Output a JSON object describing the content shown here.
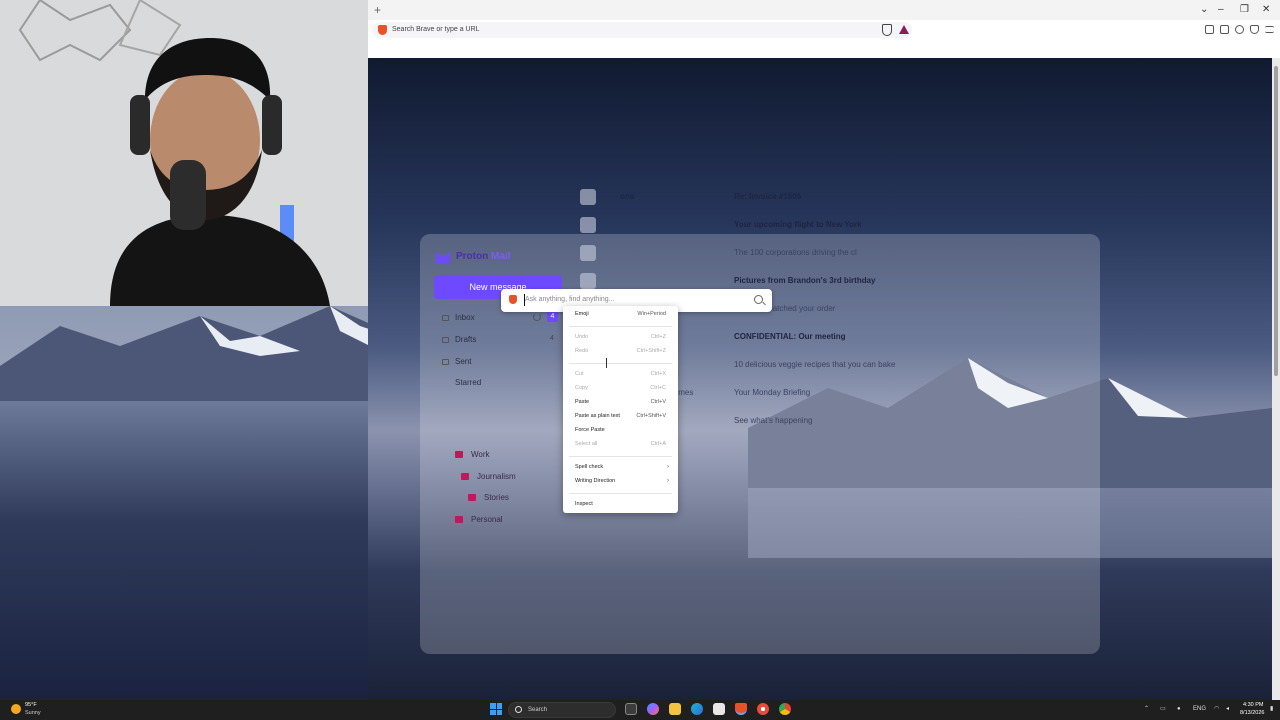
{
  "browser": {
    "newtab": "+",
    "url_placeholder": "Search Brave or type a URL",
    "win_minimize": "–",
    "win_restore": "❐",
    "win_close": "✕",
    "tab_list": "⌄"
  },
  "omnibox": {
    "placeholder": "Ask anything, find anything..."
  },
  "proton": {
    "brand_a": "Proton",
    "brand_b": "Mail",
    "new_message": "New message",
    "folders": [
      {
        "label": "Inbox",
        "count": "4"
      },
      {
        "label": "Drafts",
        "count": "4"
      },
      {
        "label": "Sent"
      },
      {
        "label": "Starred"
      }
    ],
    "labels": [
      "Work",
      "Journalism",
      "Stories",
      "Personal"
    ],
    "mails": [
      {
        "avatar": "",
        "sender": "ons",
        "subject": "Re: Invoice #1605",
        "bold": true
      },
      {
        "avatar": "",
        "sender": "",
        "subject": "Your upcoming flight to New York",
        "bold": true
      },
      {
        "avatar": "",
        "sender": "",
        "subject": "The 100 corporations driving the cl",
        "bold": false
      },
      {
        "avatar": "",
        "sender": "",
        "subject": "Pictures from Brandon's 3rd birthday",
        "bold": true
      },
      {
        "avatar": "",
        "sender": "",
        "subject": "We've dispatched your order",
        "bold": false
      },
      {
        "avatar": "",
        "sender": "",
        "subject": "CONFIDENTIAL: Our meeting",
        "bold": true
      },
      {
        "avatar": "H",
        "sender": "",
        "subject": "10 delicious veggie recipes that you can bake",
        "bold": false
      },
      {
        "avatar": "TT",
        "sender": "The New York Times",
        "subject": "Your Monday Briefing",
        "bold": false
      },
      {
        "avatar": "",
        "sender": "Twitter",
        "subject": "See what's happening",
        "bold": false
      }
    ]
  },
  "context_menu": [
    {
      "label": "Emoji",
      "shortcut": "Win+Period",
      "disabled": false
    },
    {
      "sep": true
    },
    {
      "label": "Undo",
      "shortcut": "Ctrl+Z",
      "disabled": true
    },
    {
      "label": "Redo",
      "shortcut": "Ctrl+Shift+Z",
      "disabled": true
    },
    {
      "sep": true
    },
    {
      "label": "Cut",
      "shortcut": "Ctrl+X",
      "disabled": true
    },
    {
      "label": "Copy",
      "shortcut": "Ctrl+C",
      "disabled": true
    },
    {
      "label": "Paste",
      "shortcut": "Ctrl+V",
      "disabled": false
    },
    {
      "label": "Paste as plain text",
      "shortcut": "Ctrl+Shift+V",
      "disabled": false
    },
    {
      "label": "Force Paste",
      "shortcut": "",
      "disabled": false
    },
    {
      "label": "Select all",
      "shortcut": "Ctrl+A",
      "disabled": true
    },
    {
      "sep": true
    },
    {
      "label": "Spell check",
      "submenu": true,
      "disabled": false
    },
    {
      "label": "Writing Direction",
      "submenu": true,
      "disabled": false
    },
    {
      "sep": true
    },
    {
      "label": "Inspect",
      "shortcut": "",
      "disabled": false
    }
  ],
  "taskbar": {
    "weather_temp": "95°F",
    "weather_desc": "Sunny",
    "search_label": "Search",
    "lang": "ENG",
    "time": "4:30 PM",
    "date": "8/13/2026"
  },
  "colors": {
    "proton_accent": "#6d4aff",
    "label_pink": "#c2185b",
    "brave_orange": "#e8522a"
  }
}
